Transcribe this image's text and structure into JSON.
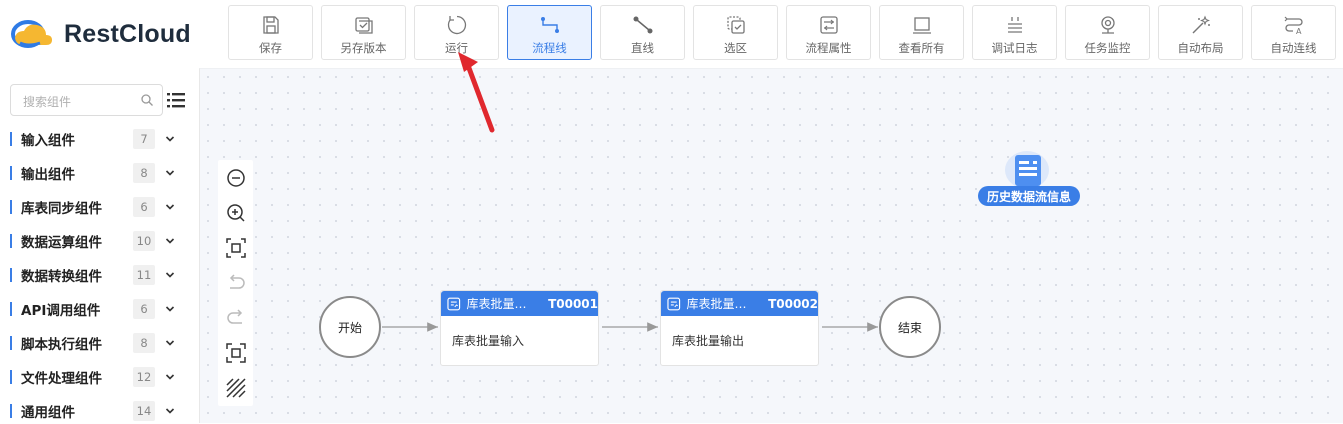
{
  "brand": {
    "name": "RestCloud",
    "accent": "#3a7ee6"
  },
  "toolbar": [
    {
      "key": "save",
      "label": "保存",
      "icon": "save-icon"
    },
    {
      "key": "save-version",
      "label": "另存版本",
      "icon": "save-version-icon"
    },
    {
      "key": "run",
      "label": "运行",
      "icon": "run-icon"
    },
    {
      "key": "flow-line",
      "label": "流程线",
      "icon": "flow-line-icon",
      "active": true
    },
    {
      "key": "straight-line",
      "label": "直线",
      "icon": "straight-line-icon"
    },
    {
      "key": "select-area",
      "label": "选区",
      "icon": "select-area-icon"
    },
    {
      "key": "flow-props",
      "label": "流程属性",
      "icon": "flow-properties-icon"
    },
    {
      "key": "view-all",
      "label": "查看所有",
      "icon": "view-all-icon"
    },
    {
      "key": "debug-log",
      "label": "调试日志",
      "icon": "debug-log-icon"
    },
    {
      "key": "task-monitor",
      "label": "任务监控",
      "icon": "task-monitor-icon"
    },
    {
      "key": "auto-layout",
      "label": "自动布局",
      "icon": "auto-layout-icon"
    },
    {
      "key": "auto-connect",
      "label": "自动连线",
      "icon": "auto-connect-icon"
    }
  ],
  "sidebar": {
    "search_placeholder": "搜索组件",
    "categories": [
      {
        "label": "输入组件",
        "count": "7"
      },
      {
        "label": "输出组件",
        "count": "8"
      },
      {
        "label": "库表同步组件",
        "count": "6"
      },
      {
        "label": "数据运算组件",
        "count": "10"
      },
      {
        "label": "数据转换组件",
        "count": "11"
      },
      {
        "label": "API调用组件",
        "count": "6"
      },
      {
        "label": "脚本执行组件",
        "count": "8"
      },
      {
        "label": "文件处理组件",
        "count": "12"
      },
      {
        "label": "通用组件",
        "count": "14"
      }
    ]
  },
  "zoom_controls": [
    "zoom-out-icon",
    "zoom-in-icon",
    "fit-screen-icon",
    "undo-icon",
    "redo-icon",
    "fullscreen-icon",
    "grid-toggle-icon"
  ],
  "flow": {
    "start_label": "开始",
    "end_label": "结束",
    "tasks": [
      {
        "title": "库表批量…",
        "code": "T00001",
        "body": "库表批量输入"
      },
      {
        "title": "库表批量…",
        "code": "T00002",
        "body": "库表批量输出"
      }
    ],
    "history_label": "历史数据流信息"
  },
  "annotation": {
    "color": "#e0282e",
    "points_to": "运行"
  }
}
